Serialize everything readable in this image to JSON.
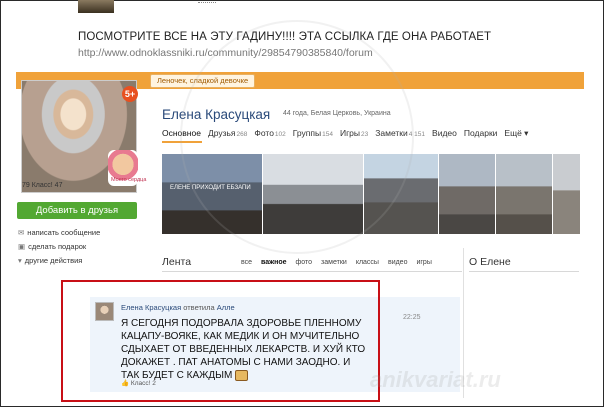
{
  "post": {
    "headline": "ПОСМОТРИТЕ ВСЕ НА ЭТУ ГАДИНУ!!!! ЭТА ССЫЛКА ГДЕ ОНА РАБОТАЕТ",
    "link": "http://www.odnoklassniki.ru/community/29854790385840/forum"
  },
  "profile": {
    "tagline": "Леночек, сладкой девочке",
    "name": "Елена Красуцкая",
    "subtitle": "44 года, Белая Церковь, Украина",
    "age_badge": "5+",
    "sticker_text": "Моего сердца",
    "stats": "79  Класс! 47",
    "add_friend": "Добавить в друзья",
    "side_links": [
      "написать сообщение",
      "сделать подарок",
      "другие действия"
    ],
    "tabs": [
      {
        "label": "Основное",
        "count": ""
      },
      {
        "label": "Друзья",
        "count": "268"
      },
      {
        "label": "Фото",
        "count": "102"
      },
      {
        "label": "Группы",
        "count": "154"
      },
      {
        "label": "Игры",
        "count": "23"
      },
      {
        "label": "Заметки",
        "count": "4 151"
      },
      {
        "label": "Видео",
        "count": ""
      },
      {
        "label": "Подарки",
        "count": ""
      },
      {
        "label": "Ещё ▾",
        "count": ""
      }
    ],
    "photo_caption": "ЕЛЕНЕ  ПРИХОДИТ  ЕБЗАПИ"
  },
  "feed": {
    "label": "Лента",
    "filters": [
      "все",
      "важное",
      "фото",
      "заметки",
      "классы",
      "видео",
      "игры"
    ],
    "about_label": "О Елене"
  },
  "entry": {
    "author": "Елена Красуцкая",
    "action": "ответила",
    "target": "Алле",
    "time": "22:25",
    "text": "Я СЕГОДНЯ  ПОДОРВАЛА ЗДОРОВЬЕ ПЛЕННОМУ КАЦАПУ-ВОЯКЕ, КАК МЕДИК И ОН МУЧИТЕЛЬНО СДЫХАЕТ ОТ ВВЕДЕННЫХ ЛЕКАРСТВ.    И ХУЙ КТО ДОКАЖЕТ . ПАТ АНАТОМЫ С НАМИ ЗАОДНО. И ТАК БУДЕТ С  КАЖДЫМ",
    "likes": "Класс! 2"
  },
  "watermark": "anikvariat.ru",
  "colors": {
    "brand_orange": "#f0a23a",
    "button_green": "#52a832",
    "highlight_red": "#c80f16",
    "link_blue": "#2a4a7a"
  }
}
